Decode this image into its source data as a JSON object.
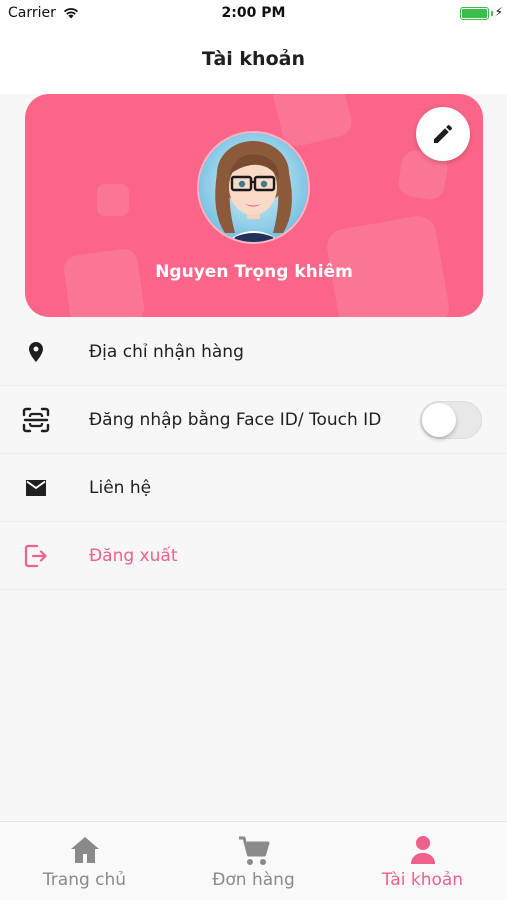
{
  "status_bar": {
    "carrier": "Carrier",
    "time": "2:00 PM",
    "battery_level": 1.0
  },
  "header": {
    "title": "Tài khoản"
  },
  "profile": {
    "name": "Nguyen Trọng khiêm",
    "avatar": "avatar-woman-glasses",
    "edit_icon": "pencil-icon"
  },
  "menu": [
    {
      "icon": "location-pin-icon",
      "label": "Địa chỉ nhận hàng"
    },
    {
      "icon": "face-id-scan-icon",
      "label": "Đăng nhập bằng Face ID/ Touch ID",
      "toggle_on": false
    },
    {
      "icon": "mail-icon",
      "label": "Liên hệ"
    },
    {
      "icon": "logout-icon",
      "label": "Đăng xuất"
    }
  ],
  "tabs": [
    {
      "icon": "home-icon",
      "label": "Trang chủ",
      "active": false
    },
    {
      "icon": "cart-icon",
      "label": "Đơn hàng",
      "active": false
    },
    {
      "icon": "person-icon",
      "label": "Tài khoản",
      "active": true
    }
  ],
  "colors": {
    "accent": "#F0608C",
    "card": "#FB6688",
    "inactive_tab": "#8A8A8A",
    "background": "#F7F7F7"
  }
}
